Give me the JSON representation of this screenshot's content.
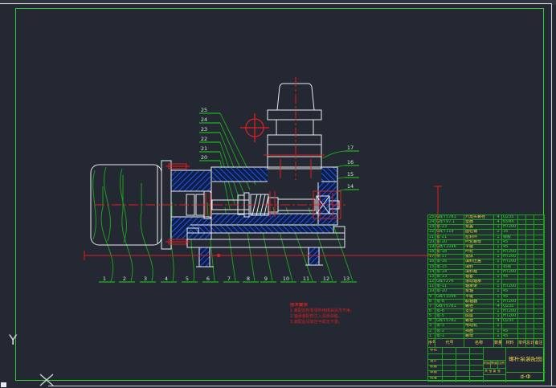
{
  "callouts": {
    "bottom": [
      "1",
      "2",
      "3",
      "4",
      "5",
      "6",
      "7",
      "8",
      "9",
      "10",
      "11",
      "12",
      "13"
    ],
    "left": [
      "25",
      "24",
      "23",
      "22",
      "21",
      "20"
    ],
    "right": [
      "17",
      "16",
      "15",
      "14"
    ]
  },
  "ucs": {
    "y_label": "Y"
  },
  "tech_requirements": {
    "title": "技术要求",
    "lines": [
      "1.装配前所有零件用煤油清洗干净。",
      "2.轴承装配时注入润滑油脂。",
      "3.装配后试转应平稳无卡滞。"
    ]
  },
  "bom": {
    "headers": [
      "序号",
      "代号",
      "名称",
      "数量",
      "材料",
      "单件",
      "总计",
      "备注"
    ],
    "rows": [
      {
        "seq": "25",
        "code": "GB/T5781",
        "name": "六角头螺栓",
        "qty": "4",
        "material": "Q235"
      },
      {
        "seq": "24",
        "code": "GB/T97.1",
        "name": "垫圈",
        "qty": "4",
        "material": "65Mn"
      },
      {
        "seq": "23",
        "code": "泵-23",
        "name": "泵盖",
        "qty": "1",
        "material": "HT200"
      },
      {
        "seq": "22",
        "code": "GB/T119",
        "name": "圆柱销",
        "qty": "2",
        "material": "35"
      },
      {
        "seq": "21",
        "code": "泵-21",
        "name": "密封环",
        "qty": "1",
        "material": "橡胶"
      },
      {
        "seq": "20",
        "code": "泵-20",
        "name": "叶轮螺母",
        "qty": "1",
        "material": "45"
      },
      {
        "seq": "19",
        "code": "GB/T1096",
        "name": "平键",
        "qty": "1",
        "material": "45"
      },
      {
        "seq": "18",
        "code": "泵-18",
        "name": "叶轮",
        "qty": "1",
        "material": "HT200"
      },
      {
        "seq": "17",
        "code": "泵-17",
        "name": "泵体",
        "qty": "1",
        "material": "HT200"
      },
      {
        "seq": "16",
        "code": "泵-16",
        "name": "填料压盖",
        "qty": "1",
        "material": "HT200"
      },
      {
        "seq": "15",
        "code": "泵-15",
        "name": "填料",
        "qty": "1",
        "material": "石棉"
      },
      {
        "seq": "14",
        "code": "泵-14",
        "name": "填料箱",
        "qty": "1",
        "material": "HT200"
      },
      {
        "seq": "13",
        "code": "泵-13",
        "name": "轴套",
        "qty": "1",
        "material": "45"
      },
      {
        "seq": "12",
        "code": "GB/T276",
        "name": "滚动轴承",
        "qty": "2",
        "material": ""
      },
      {
        "seq": "11",
        "code": "泵-11",
        "name": "轴承架",
        "qty": "1",
        "material": "HT200"
      },
      {
        "seq": "10",
        "code": "泵-10",
        "name": "泵轴",
        "qty": "1",
        "material": "45"
      },
      {
        "seq": "9",
        "code": "GB/T1096",
        "name": "平键",
        "qty": "1",
        "material": "45"
      },
      {
        "seq": "8",
        "code": "泵-8",
        "name": "联轴器",
        "qty": "1",
        "material": "HT200"
      },
      {
        "seq": "7",
        "code": "GB/T5781",
        "name": "螺栓",
        "qty": "4",
        "material": "Q235"
      },
      {
        "seq": "6",
        "code": "泵-6",
        "name": "支架",
        "qty": "1",
        "material": "HT200"
      },
      {
        "seq": "5",
        "code": "泵-5",
        "name": "底座",
        "qty": "1",
        "material": "HT200"
      },
      {
        "seq": "4",
        "code": "GB/T5782",
        "name": "螺栓",
        "qty": "4",
        "material": "Q235"
      },
      {
        "seq": "3",
        "code": "泵-3",
        "name": "电动机",
        "qty": "1",
        "material": ""
      },
      {
        "seq": "2",
        "code": "泵-2",
        "name": "挡圈",
        "qty": "1",
        "material": "45"
      },
      {
        "seq": "1",
        "code": "泵-1",
        "name": "螺母",
        "qty": "1",
        "material": "45"
      }
    ]
  },
  "title_block": {
    "title": "螺杆泵装配图",
    "drawing_no": "d-Ф",
    "mark": "标记",
    "design": "设计",
    "check": "校核",
    "review": "审核",
    "approve": "批准",
    "stage": "阶段标记",
    "qty": "数量",
    "scale": "比例",
    "sheet": "共 张 第 张"
  }
}
